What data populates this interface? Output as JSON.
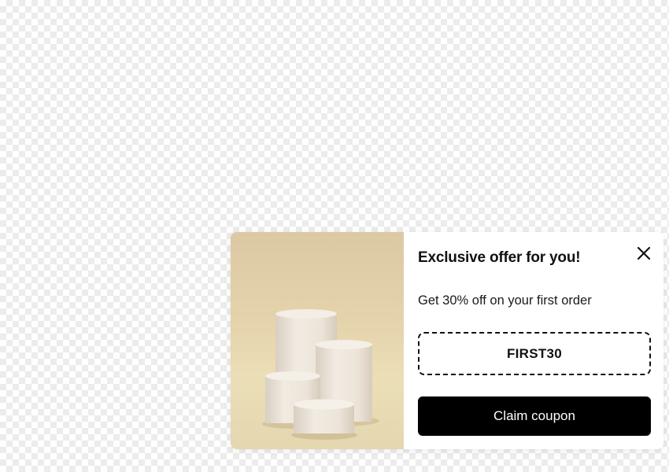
{
  "popup": {
    "image_alt": "product-podiums",
    "title": "Exclusive offer for you!",
    "subtitle": "Get 30% off on your first order",
    "coupon_code": "FIRST30",
    "claim_label": "Claim coupon",
    "close_icon": "close-icon"
  },
  "colors": {
    "accent": "#000000",
    "image_background": "#e6d4ad",
    "podium": "#ede6dc"
  }
}
